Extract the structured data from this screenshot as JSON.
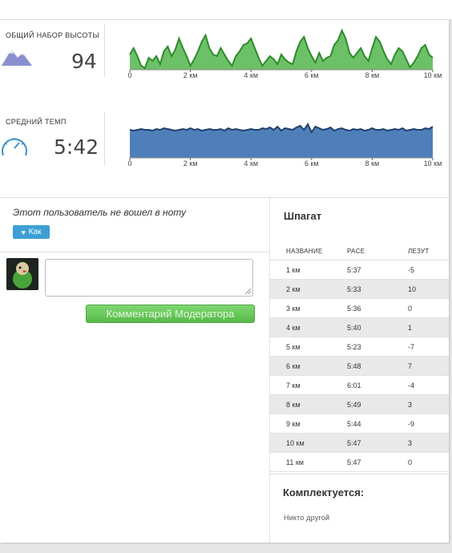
{
  "elevation": {
    "label": "ОБЩИЙ НАБОР ВЫСОТЫ",
    "value": "94",
    "ticks": [
      "0",
      "2 км",
      "4 км",
      "6 км",
      "8 км",
      "10 км"
    ]
  },
  "pace": {
    "label": "СРЕДНИЙ ТЕМП",
    "value": "5:42",
    "ticks": [
      "0",
      "2 км",
      "4 км",
      "6 км",
      "8 км",
      "10 км"
    ]
  },
  "likes": {
    "text": "Этот пользователь не вошел в ноту",
    "like_label": "Как"
  },
  "comment": {
    "placeholder": "",
    "button_label": "Комментарий Модератора"
  },
  "splits": {
    "title": "Шпагат",
    "headers": [
      "НАЗВАНИЕ",
      "PACE",
      "ЛЕЗУТ"
    ],
    "rows": [
      [
        "1 км",
        "5:37",
        "-5"
      ],
      [
        "2 км",
        "5:33",
        "10"
      ],
      [
        "3 км",
        "5:36",
        "0"
      ],
      [
        "4 км",
        "5:40",
        "1"
      ],
      [
        "5 км",
        "5:23",
        "-7"
      ],
      [
        "6 км",
        "5:48",
        "7"
      ],
      [
        "7 км",
        "6:01",
        "-4"
      ],
      [
        "8 км",
        "5:49",
        "3"
      ],
      [
        "9 км",
        "5:44",
        "-9"
      ],
      [
        "10 км",
        "5:47",
        "3"
      ],
      [
        "11 км",
        "5:47",
        "0"
      ]
    ]
  },
  "completed": {
    "title": "Комплектуется:",
    "text": "Никто другой"
  },
  "colors": {
    "elevation_fill": "#6cc067",
    "elevation_line": "#2e8b2c",
    "pace_fill": "#4f7fb9",
    "pace_line": "#1f3f6e",
    "like_button": "#3c9fd4",
    "moderator_button": "#66c95a"
  }
}
